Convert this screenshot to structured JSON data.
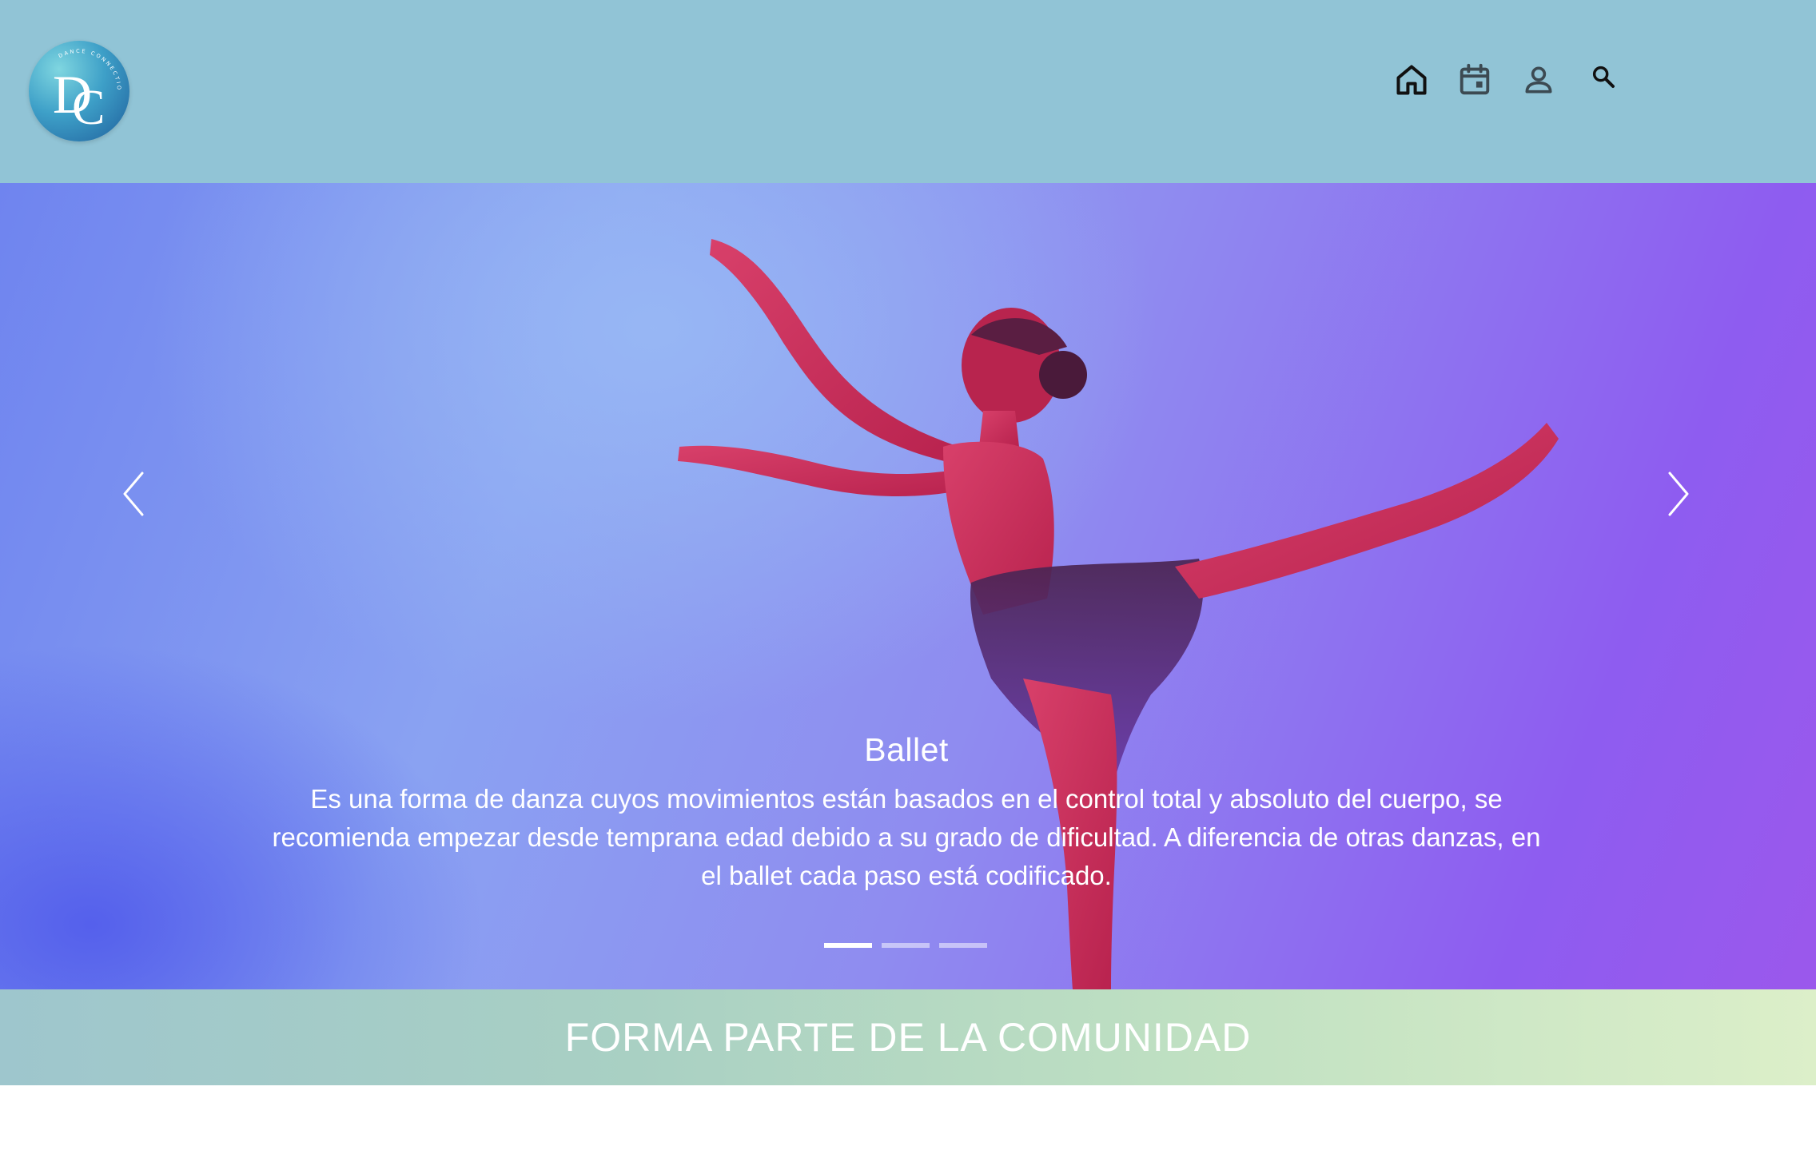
{
  "header": {
    "logo": {
      "monogram_d": "D",
      "monogram_c": "C",
      "ring_text": "DANCE CONNECTION"
    },
    "nav": [
      {
        "icon": "home-icon"
      },
      {
        "icon": "calendar-icon"
      },
      {
        "icon": "user-icon"
      },
      {
        "icon": "search-icon"
      }
    ],
    "background_color": "#91c4d6"
  },
  "carousel": {
    "active_index": 0,
    "slide_count": 3,
    "slide": {
      "title": "Ballet",
      "text": "Es una forma de danza cuyos movimientos están basados en el control total y absoluto del cuerpo, se recomienda empezar desde temprana edad debido a su grado de dificultad. A diferencia de otras danzas, en el ballet cada paso está codificado."
    },
    "controls": {
      "prev_icon": "chevron-left-icon",
      "next_icon": "chevron-right-icon"
    }
  },
  "community": {
    "title": "FORMA PARTE DE LA COMUNIDAD"
  }
}
